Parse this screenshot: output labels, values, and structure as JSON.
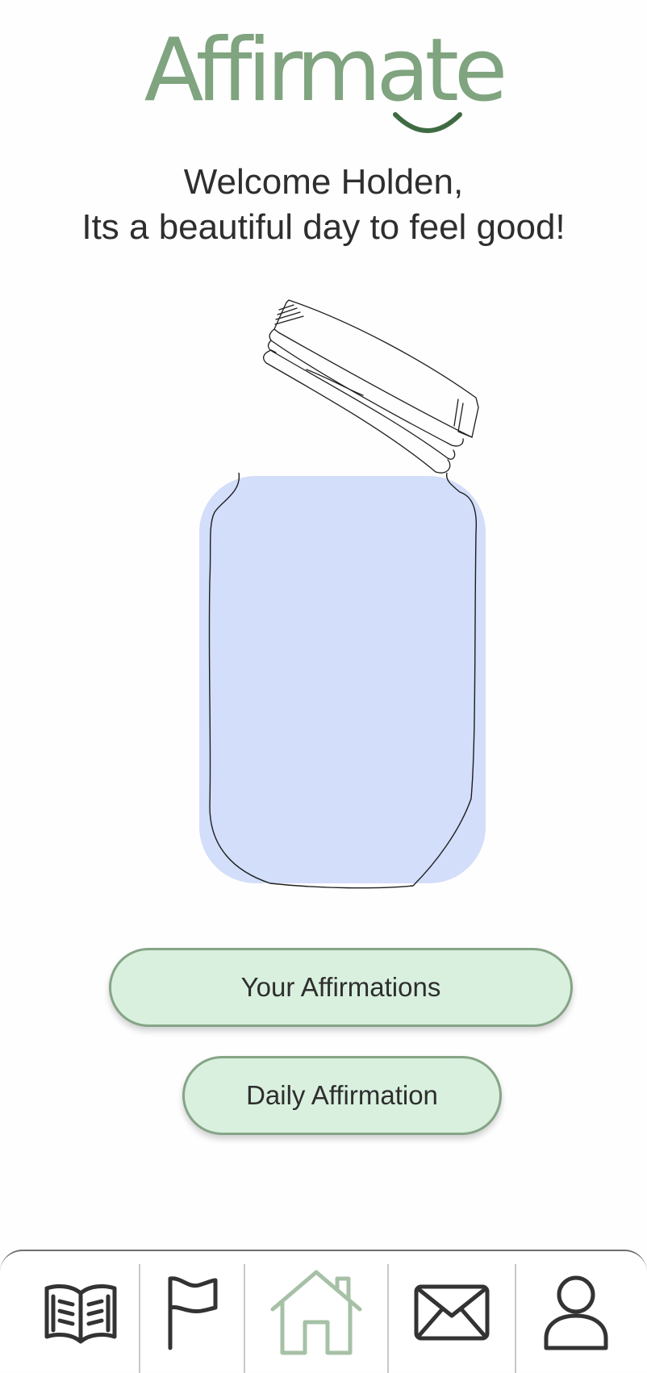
{
  "app": {
    "name": "Affirmate",
    "brand_color": "#7fa47f",
    "brand_dark": "#3f6b42"
  },
  "greeting": {
    "line1": "Welcome Holden,",
    "line2": "Its a beautiful day to feel good!"
  },
  "jar": {
    "icon": "jar-illustration",
    "fill_color": "#d2defa"
  },
  "buttons": {
    "affirmations_label": "Your Affirmations",
    "daily_label": "Daily Affirmation",
    "fill_color": "#d9f0de",
    "border_color": "#86a486"
  },
  "nav": {
    "items": [
      {
        "icon": "book-icon"
      },
      {
        "icon": "flag-icon"
      },
      {
        "icon": "home-icon",
        "active": true
      },
      {
        "icon": "mail-icon"
      },
      {
        "icon": "user-icon"
      }
    ],
    "active_color": "#a6c1a6",
    "inactive_color": "#333333"
  }
}
